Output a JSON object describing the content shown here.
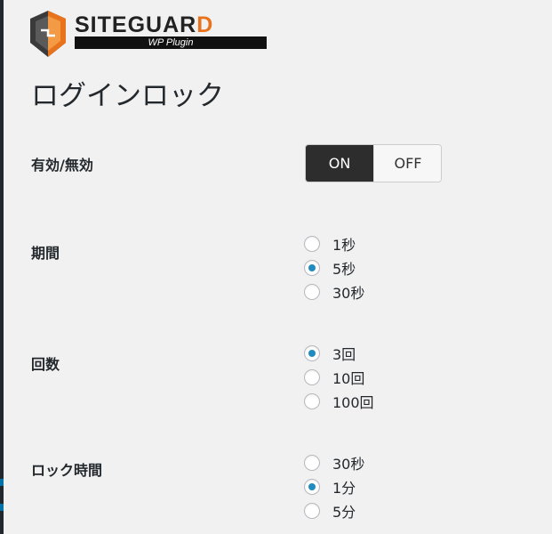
{
  "logo": {
    "name_main": "SITEGUAR",
    "name_accent": "D",
    "subtitle": "WP Plugin"
  },
  "page_title": "ログインロック",
  "enable": {
    "label": "有効/無効",
    "on_label": "ON",
    "off_label": "OFF",
    "selected": "ON"
  },
  "period": {
    "label": "期間",
    "options": [
      {
        "label": "1秒",
        "checked": false
      },
      {
        "label": "5秒",
        "checked": true
      },
      {
        "label": "30秒",
        "checked": false
      }
    ]
  },
  "count": {
    "label": "回数",
    "options": [
      {
        "label": "3回",
        "checked": true
      },
      {
        "label": "10回",
        "checked": false
      },
      {
        "label": "100回",
        "checked": false
      }
    ]
  },
  "lock_time": {
    "label": "ロック時間",
    "options": [
      {
        "label": "30秒",
        "checked": false
      },
      {
        "label": "1分",
        "checked": true
      },
      {
        "label": "5分",
        "checked": false
      }
    ]
  },
  "colors": {
    "radio_checked": "#1e8cbe",
    "toggle_active_bg": "#2d2d2d",
    "logo_accent": "#e8731c"
  }
}
